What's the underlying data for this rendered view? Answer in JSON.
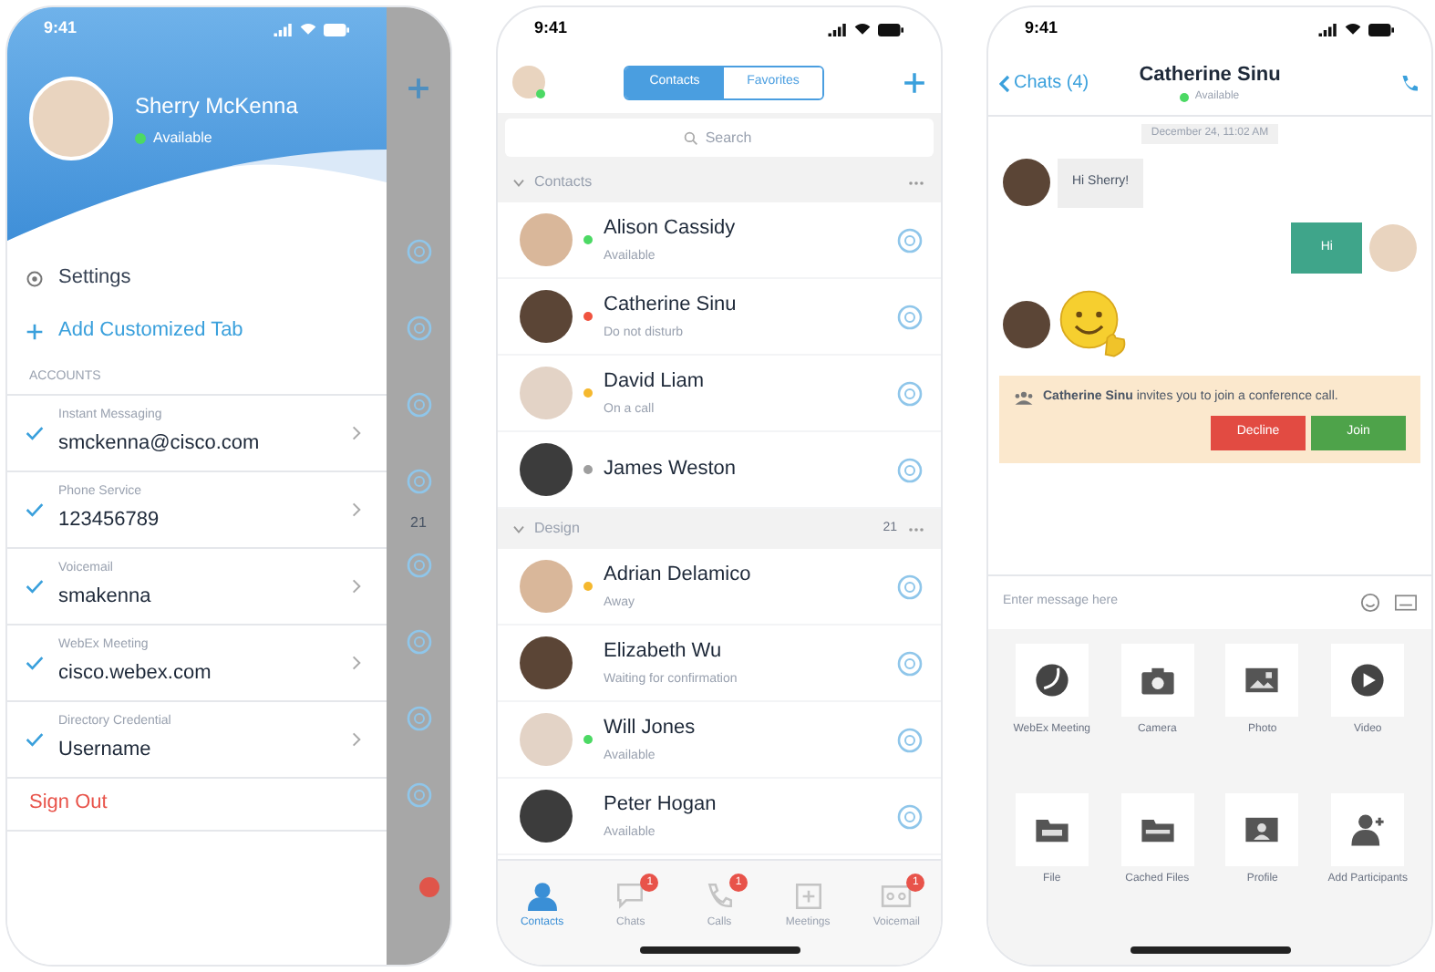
{
  "menu_screen": {
    "status_time": "9:41",
    "profile": {
      "name": "Sherry McKenna",
      "status": "Available"
    },
    "actions": [
      {
        "kind": "settings",
        "label": "Settings"
      },
      {
        "kind": "add",
        "label": "Add Customized Tab"
      }
    ],
    "section_title": "ACCOUNTS",
    "accounts": [
      {
        "label": "Instant Messaging",
        "value": "smckenna@cisco.com",
        "checked": true
      },
      {
        "label": "Phone Service",
        "value": "123456789",
        "checked": true
      },
      {
        "label": "Voicemail",
        "value": "smakenna",
        "checked": true
      },
      {
        "label": "WebEx Meeting",
        "value": "cisco.webex.com",
        "checked": true
      },
      {
        "label": "Directory Credential",
        "value": "Username",
        "checked": true
      }
    ],
    "sign_out": "Sign Out",
    "background_group_count": "21"
  },
  "contacts_screen": {
    "status_time": "9:41",
    "tabs": [
      {
        "label": "Contacts",
        "selected": true
      },
      {
        "label": "Favorites",
        "selected": false
      }
    ],
    "search": {
      "placeholder": "Search"
    },
    "groups": [
      {
        "title": "Contacts",
        "expanded": true,
        "contacts": [
          {
            "name": "Alison Cassidy",
            "status": "Available",
            "color": "#4cd964"
          },
          {
            "name": "Catherine Sinu",
            "status": "Do not disturb",
            "color": "#f0533f"
          },
          {
            "name": "David Liam",
            "status": "On a call",
            "color": "#f5b82e"
          },
          {
            "name": "James Weston",
            "color": "#9e9e9e"
          }
        ]
      },
      {
        "title": "Design",
        "count": "21",
        "expanded": true,
        "contacts": [
          {
            "name": "Adrian Delamico",
            "status": "Away",
            "color": "#f5b82e"
          },
          {
            "name": "Elizabeth Wu",
            "status": "Waiting for confirmation"
          },
          {
            "name": "Will Jones",
            "status": "Available",
            "color": "#4cd964"
          },
          {
            "name": "Peter Hogan",
            "status": "Available"
          }
        ]
      }
    ],
    "bottom_tabs": [
      {
        "kind": "contacts",
        "label": "Contacts",
        "selected": true
      },
      {
        "kind": "chats",
        "label": "Chats",
        "badge": "1",
        "selected": false
      },
      {
        "kind": "calls",
        "label": "Calls",
        "badge": "1",
        "selected": false
      },
      {
        "kind": "meetings",
        "label": "Meetings",
        "selected": false
      },
      {
        "kind": "voicemail",
        "label": "Voicemail",
        "badge": "1",
        "selected": false
      }
    ]
  },
  "chat_screen": {
    "status_time": "9:41",
    "back_label": "Chats (4)",
    "contact": {
      "name": "Catherine Sinu",
      "status": "Available"
    },
    "date": "December 24, 11:02 AM",
    "messages": [
      {
        "kind": "text",
        "text": "Hi Sherry!",
        "outgoing": false
      },
      {
        "kind": "text",
        "text": "Hi",
        "outgoing": true
      },
      {
        "kind": "emoji",
        "outgoing": false
      }
    ],
    "invite": {
      "text": "**Catherine Sinu** invites you to join a conference call.",
      "buttons": [
        {
          "kind": "decline",
          "label": "Decline"
        },
        {
          "kind": "join",
          "label": "Join"
        }
      ]
    },
    "composer": {
      "placeholder": "Enter message here"
    },
    "attachments": [
      {
        "kind": "webex",
        "label": "WebEx Meeting"
      },
      {
        "kind": "camera",
        "label": "Camera"
      },
      {
        "kind": "photo",
        "label": "Photo"
      },
      {
        "kind": "video",
        "label": "Video"
      },
      {
        "kind": "file",
        "label": "File"
      },
      {
        "kind": "cached",
        "label": "Cached Files"
      },
      {
        "kind": "profile",
        "label": "Profile"
      },
      {
        "kind": "add-person",
        "label": "Add Participants"
      }
    ]
  }
}
